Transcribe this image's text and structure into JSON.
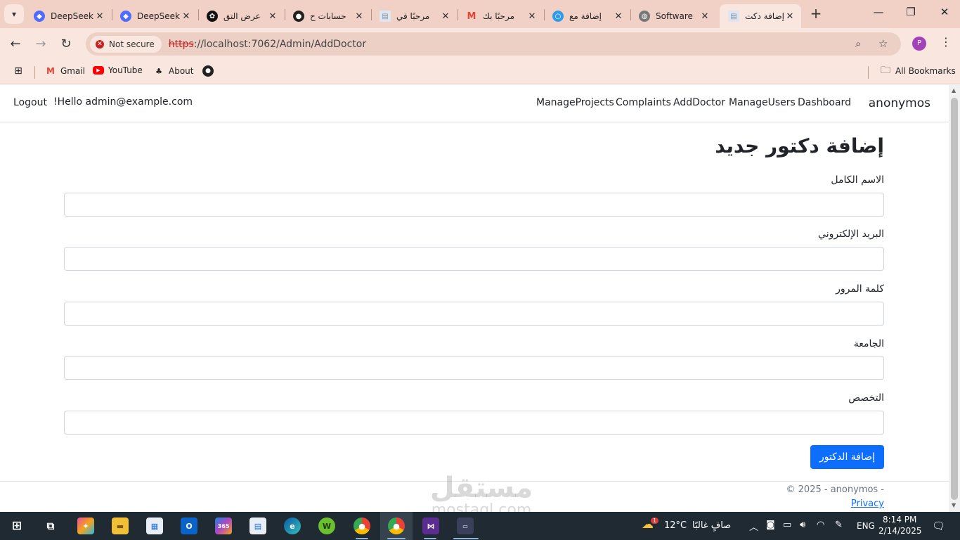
{
  "browser": {
    "tabs": [
      {
        "title": "DeepSeek",
        "favicon": "deepseek-icon",
        "color": "#4d6bfe"
      },
      {
        "title": "DeepSeek",
        "favicon": "deepseek-icon",
        "color": "#4d6bfe"
      },
      {
        "title": "عرض التق",
        "favicon": "openai-icon",
        "color": "#111111"
      },
      {
        "title": "حسابات ح",
        "favicon": "dot-icon",
        "color": "#222222"
      },
      {
        "title": "مرحبًا في",
        "favicon": "document-icon",
        "color": "#7d8fa8"
      },
      {
        "title": "مرحبًا بك",
        "favicon": "gmail-icon",
        "color": "#ea4335"
      },
      {
        "title": "إضافة مع",
        "favicon": "circle-app-icon",
        "color": "#2f9be8"
      },
      {
        "title": "Software",
        "favicon": "globe-icon",
        "color": "#666666"
      },
      {
        "title": "إضافة دكت",
        "favicon": "document-icon",
        "color": "#7d8fa8",
        "active": true
      }
    ],
    "address": {
      "security_label": "Not secure",
      "url_protocol": "https",
      "url_rest": "://localhost:7062/Admin/AddDoctor"
    },
    "profile_initial": "P",
    "bookmarks": [
      {
        "label": "Gmail",
        "icon": "gmail-icon"
      },
      {
        "label": "YouTube",
        "icon": "youtube-icon"
      },
      {
        "label": "About",
        "icon": "about-icon"
      },
      {
        "label": "",
        "icon": "github-icon"
      }
    ],
    "all_bookmarks": "All Bookmarks"
  },
  "navbar": {
    "brand": "anonymos",
    "links": [
      "Dashboard",
      "ManageUsers",
      "AddDoctor",
      "Complaints",
      "ManageProjects"
    ],
    "greeting": "!Hello admin@example.com",
    "logout": "Logout"
  },
  "form": {
    "title": "إضافة دكتور جديد",
    "fields": [
      {
        "label": "الاسم الكامل",
        "value": ""
      },
      {
        "label": "البريد الإلكتروني",
        "value": ""
      },
      {
        "label": "كلمة المرور",
        "value": ""
      },
      {
        "label": "الجامعة",
        "value": ""
      },
      {
        "label": "التخصص",
        "value": ""
      }
    ],
    "submit": "إضافة الدكتور"
  },
  "footer": {
    "copyright": "© 2025 - anonymos -",
    "privacy": "Privacy"
  },
  "watermark": {
    "line1": "مستقل",
    "line2": "mostaql.com"
  },
  "taskbar": {
    "weather_temp": "12°C",
    "weather_text": "صافٍ غالبًا",
    "weather_badge": "1",
    "language": "ENG",
    "time": "8:14 PM",
    "date": "2/14/2025"
  },
  "colors": {
    "primary": "#0d6efd",
    "tab_strip": "#f1d0c6",
    "toolbar": "#f9e6df",
    "taskbar": "#1f2a33"
  }
}
